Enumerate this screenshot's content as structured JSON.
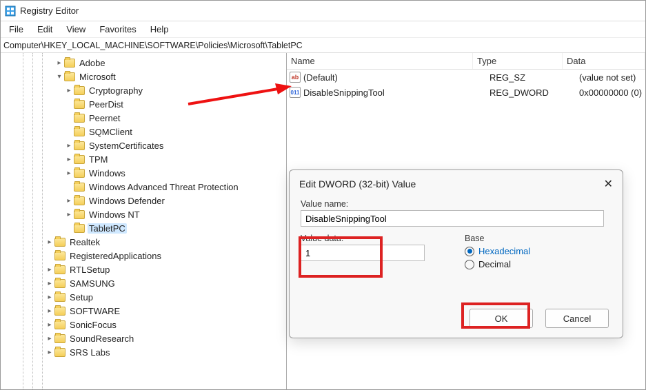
{
  "window": {
    "title": "Registry Editor"
  },
  "menu": {
    "file": "File",
    "edit": "Edit",
    "view": "View",
    "favorites": "Favorites",
    "help": "Help"
  },
  "address": "Computer\\HKEY_LOCAL_MACHINE\\SOFTWARE\\Policies\\Microsoft\\TabletPC",
  "tree": {
    "n0": {
      "label": "Adobe",
      "caret": "right",
      "indent": 5
    },
    "n1": {
      "label": "Microsoft",
      "caret": "down",
      "indent": 5
    },
    "n2": {
      "label": "Cryptography",
      "caret": "right",
      "indent": 6
    },
    "n3": {
      "label": "PeerDist",
      "caret": "",
      "indent": 6
    },
    "n4": {
      "label": "Peernet",
      "caret": "",
      "indent": 6
    },
    "n5": {
      "label": "SQMClient",
      "caret": "",
      "indent": 6
    },
    "n6": {
      "label": "SystemCertificates",
      "caret": "right",
      "indent": 6
    },
    "n7": {
      "label": "TPM",
      "caret": "right",
      "indent": 6
    },
    "n8": {
      "label": "Windows",
      "caret": "right",
      "indent": 6
    },
    "n9": {
      "label": "Windows Advanced Threat Protection",
      "caret": "",
      "indent": 6
    },
    "n10": {
      "label": "Windows Defender",
      "caret": "right",
      "indent": 6
    },
    "n11": {
      "label": "Windows NT",
      "caret": "right",
      "indent": 6
    },
    "n12": {
      "label": "TabletPC",
      "caret": "",
      "indent": 6,
      "selected": true
    },
    "n13": {
      "label": "Realtek",
      "caret": "right",
      "indent": 4
    },
    "n14": {
      "label": "RegisteredApplications",
      "caret": "",
      "indent": 4
    },
    "n15": {
      "label": "RTLSetup",
      "caret": "right",
      "indent": 4
    },
    "n16": {
      "label": "SAMSUNG",
      "caret": "right",
      "indent": 4
    },
    "n17": {
      "label": "Setup",
      "caret": "right",
      "indent": 4
    },
    "n18": {
      "label": "SOFTWARE",
      "caret": "right",
      "indent": 4
    },
    "n19": {
      "label": "SonicFocus",
      "caret": "right",
      "indent": 4
    },
    "n20": {
      "label": "SoundResearch",
      "caret": "right",
      "indent": 4
    },
    "n21": {
      "label": "SRS Labs",
      "caret": "right",
      "indent": 4
    }
  },
  "list": {
    "cols": {
      "name": "Name",
      "type": "Type",
      "data": "Data"
    },
    "r0": {
      "name": "(Default)",
      "type": "REG_SZ",
      "data": "(value not set)",
      "icon": "ab"
    },
    "r1": {
      "name": "DisableSnippingTool",
      "type": "REG_DWORD",
      "data": "0x00000000 (0)",
      "icon": "bin"
    }
  },
  "dialog": {
    "title": "Edit DWORD (32-bit) Value",
    "valueNameLabel": "Value name:",
    "valueName": "DisableSnippingTool",
    "valueDataLabel": "Value data:",
    "valueData": "1",
    "baseLabel": "Base",
    "hex": "Hexadecimal",
    "dec": "Decimal",
    "ok": "OK",
    "cancel": "Cancel"
  }
}
